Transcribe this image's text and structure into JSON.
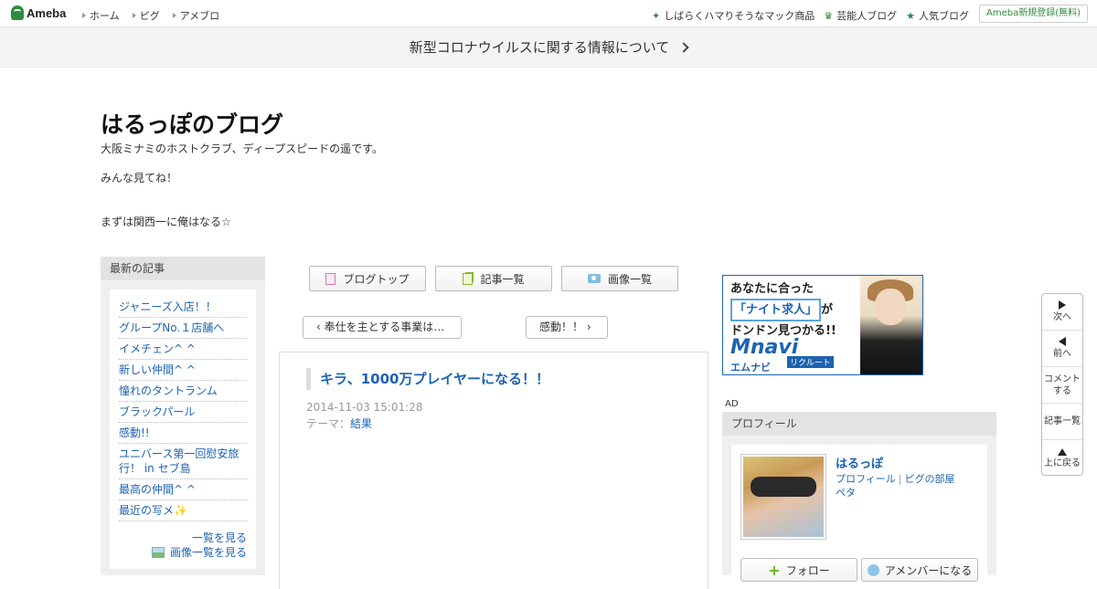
{
  "topbar": {
    "logo": "Ameba",
    "nav": [
      "ホーム",
      "ピグ",
      "アメブロ"
    ],
    "links": [
      {
        "icon": "sparkle-icon",
        "label": "しばらくハマりそうなマック商品"
      },
      {
        "icon": "crown-icon",
        "label": "芸能人ブログ"
      },
      {
        "icon": "star-icon",
        "label": "人気ブログ"
      }
    ],
    "register": "Ameba新規登録(無料)"
  },
  "notice": "新型コロナウイルスに関する情報について",
  "blog": {
    "title": "はるっぽのブログ",
    "desc1": "大阪ミナミのホストクラブ、ディープスピードの遥です。",
    "desc2": "みんな見てね！",
    "desc3": "まずは関西一に俺はなる☆"
  },
  "sidebar": {
    "heading": "最新の記事",
    "items": [
      "ジャニーズ入店！！",
      "グループNo.１店舗へ",
      "イメチェン^ ^",
      "新しい仲間^ ^",
      "憧れのタントランム",
      "ブラックパール",
      "感動!!",
      "ユニバース第一回慰安旅行！ in セブ島",
      "最高の仲間^ ^",
      "最近の写メ✨"
    ],
    "more": "一覧を見る",
    "images_more": "画像一覧を見る"
  },
  "tabs": {
    "top": "ブログトップ",
    "list": "記事一覧",
    "images": "画像一覧"
  },
  "pager": {
    "prev": "奉仕を主とする事業は…",
    "next": "感動！！"
  },
  "entry": {
    "title": "キラ、1000万プレイヤーになる！！",
    "date": "2014-11-03 15:01:28",
    "theme_label": "テーマ：",
    "theme": "結果"
  },
  "ad": {
    "line1": "あなたに合った",
    "highlight": "「ナイト求人」",
    "line2_suffix": "が",
    "line3": "ドンドン見つかる!!",
    "brand": "Mnavi",
    "brand_kana": "エムナビ",
    "brand_tag": "リクルート",
    "label": "AD"
  },
  "profile": {
    "heading": "プロフィール",
    "name": "はるっぽ",
    "link_profile": "プロフィール",
    "link_room": "ピグの部屋",
    "link_peta": "ペタ",
    "follow": "フォロー",
    "member": "アメンバーになる"
  },
  "floatnav": {
    "next": "次へ",
    "prev": "前へ",
    "comment": "コメントする",
    "list": "記事一覧",
    "top": "上に戻る"
  },
  "colors": {
    "link": "#1e63b0",
    "brand_green": "#2d8c3c"
  }
}
